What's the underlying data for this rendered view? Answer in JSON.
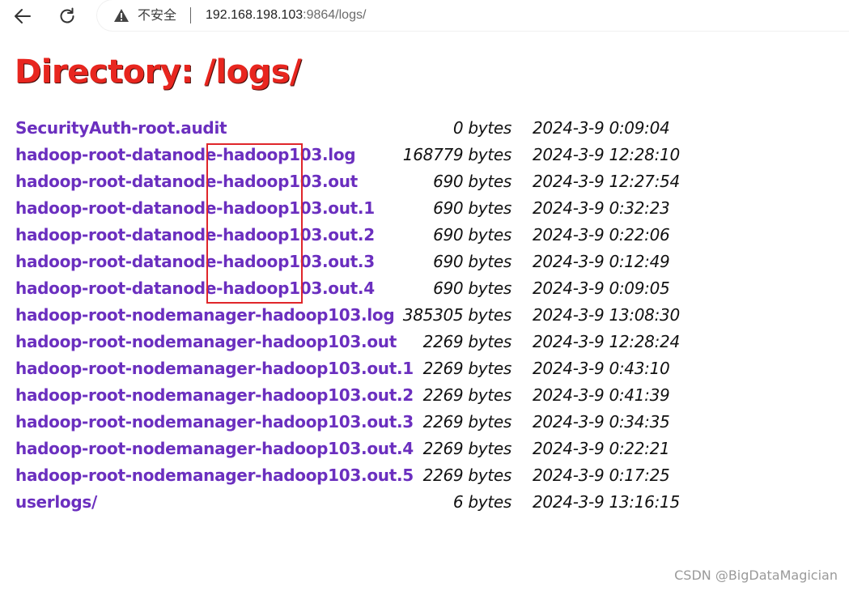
{
  "browser": {
    "security_label": "不安全",
    "url_host": "192.168.198.103",
    "url_rest": ":9864/logs/"
  },
  "page": {
    "title": "Directory: /logs/"
  },
  "files": [
    {
      "name": "SecurityAuth-root.audit",
      "size": "0 bytes",
      "date": "2024-3-9 0:09:04"
    },
    {
      "name": "hadoop-root-datanode-hadoop103.log",
      "size": "168779 bytes",
      "date": "2024-3-9 12:28:10"
    },
    {
      "name": "hadoop-root-datanode-hadoop103.out",
      "size": "690 bytes",
      "date": "2024-3-9 12:27:54"
    },
    {
      "name": "hadoop-root-datanode-hadoop103.out.1",
      "size": "690 bytes",
      "date": "2024-3-9 0:32:23"
    },
    {
      "name": "hadoop-root-datanode-hadoop103.out.2",
      "size": "690 bytes",
      "date": "2024-3-9 0:22:06"
    },
    {
      "name": "hadoop-root-datanode-hadoop103.out.3",
      "size": "690 bytes",
      "date": "2024-3-9 0:12:49"
    },
    {
      "name": "hadoop-root-datanode-hadoop103.out.4",
      "size": "690 bytes",
      "date": "2024-3-9 0:09:05"
    },
    {
      "name": "hadoop-root-nodemanager-hadoop103.log",
      "size": "385305 bytes",
      "date": "2024-3-9 13:08:30"
    },
    {
      "name": "hadoop-root-nodemanager-hadoop103.out",
      "size": "2269 bytes",
      "date": "2024-3-9 12:28:24"
    },
    {
      "name": "hadoop-root-nodemanager-hadoop103.out.1",
      "size": "2269 bytes",
      "date": "2024-3-9 0:43:10"
    },
    {
      "name": "hadoop-root-nodemanager-hadoop103.out.2",
      "size": "2269 bytes",
      "date": "2024-3-9 0:41:39"
    },
    {
      "name": "hadoop-root-nodemanager-hadoop103.out.3",
      "size": "2269 bytes",
      "date": "2024-3-9 0:34:35"
    },
    {
      "name": "hadoop-root-nodemanager-hadoop103.out.4",
      "size": "2269 bytes",
      "date": "2024-3-9 0:22:21"
    },
    {
      "name": "hadoop-root-nodemanager-hadoop103.out.5",
      "size": "2269 bytes",
      "date": "2024-3-9 0:17:25"
    },
    {
      "name": "userlogs/",
      "size": "6 bytes",
      "date": "2024-3-9 13:16:15"
    }
  ],
  "watermark": "CSDN @BigDataMagician",
  "colors": {
    "title": "#e8261f",
    "link": "#6b2fbf",
    "highlight_box": "#e0262a"
  }
}
